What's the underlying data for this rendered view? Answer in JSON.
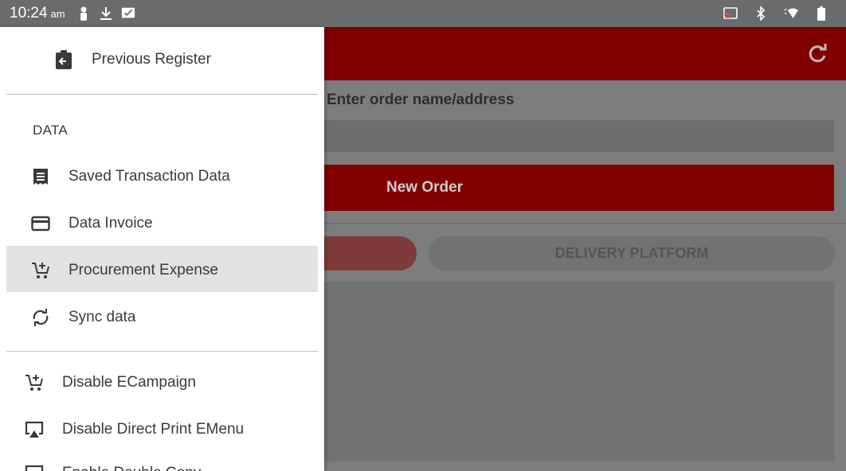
{
  "status_bar": {
    "time": "10:24",
    "ampm": "am",
    "left_icons": [
      "user-icon",
      "download-icon",
      "checkbox-icon"
    ],
    "right_icons": [
      "cast-icon",
      "bluetooth-icon",
      "wifi-icon",
      "battery-icon"
    ]
  },
  "app": {
    "appbar_color": "#800000",
    "order_label": "Enter order name/address",
    "new_order_label": "New Order",
    "tab_delivery_label": "DELIVERY PLATFORM"
  },
  "drawer": {
    "previous_register": "Previous Register",
    "section_data": "DATA",
    "items": [
      {
        "label": "Saved Transaction Data",
        "icon": "receipt-icon"
      },
      {
        "label": "Data Invoice",
        "icon": "credit-card-icon"
      },
      {
        "label": "Procurement Expense",
        "icon": "add-cart-icon",
        "selected": true
      },
      {
        "label": "Sync data",
        "icon": "sync-icon"
      }
    ],
    "bottom_items": [
      {
        "label": "Disable ECampaign",
        "icon": "add-cart-icon"
      },
      {
        "label": "Disable Direct Print EMenu",
        "icon": "airplay-icon"
      },
      {
        "label": "Enable Double Copy",
        "icon": "monitor-icon"
      }
    ]
  }
}
